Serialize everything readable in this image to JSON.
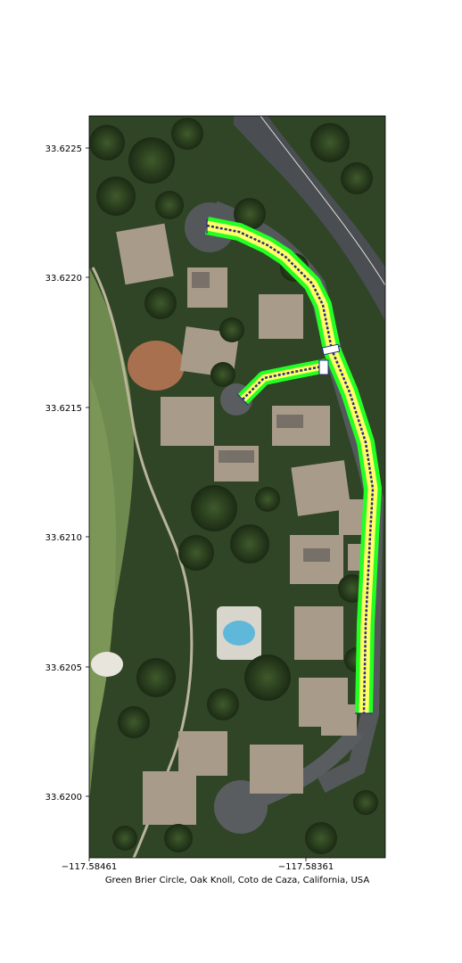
{
  "map": {
    "xlabel": "Green Brier Circle, Oak Knoll, Coto de Caza, California, USA",
    "x_ticks": [
      "−117.58461",
      "−117.58361"
    ],
    "y_ticks": [
      "33.6225",
      "33.6220",
      "33.6215",
      "33.6210",
      "33.6205",
      "33.6200"
    ],
    "layers": {
      "background": "satellite-imagery",
      "route_buffer_color": "#22ff22",
      "route_inner_color": "#ffff66",
      "route_line_color": "#2a2a8a"
    }
  }
}
